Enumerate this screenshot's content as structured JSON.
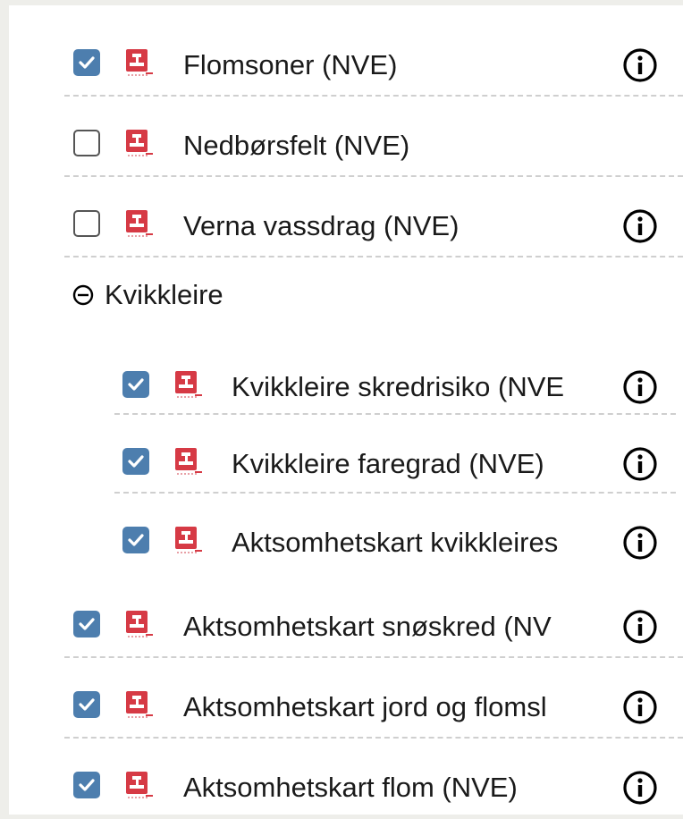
{
  "layers": [
    {
      "label": "Flomsoner (NVE)",
      "checked": true,
      "info": true
    },
    {
      "label": "Nedbørsfelt (NVE)",
      "checked": false,
      "info": false
    },
    {
      "label": "Verna vassdrag (NVE)",
      "checked": false,
      "info": true
    }
  ],
  "group": {
    "label": "Kvikkleire",
    "expanded": true,
    "children": [
      {
        "label": "Kvikkleire skredrisiko (NVE",
        "checked": true,
        "info": true
      },
      {
        "label": "Kvikkleire faregrad (NVE)",
        "checked": true,
        "info": true
      },
      {
        "label": "Aktsomhetskart kvikkleires",
        "checked": true,
        "info": true
      }
    ]
  },
  "layers_after": [
    {
      "label": "Aktsomhetskart snøskred (NV",
      "checked": true,
      "info": true
    },
    {
      "label": "Aktsomhetskart jord og flomsl",
      "checked": true,
      "info": true
    },
    {
      "label": "Aktsomhetskart flom (NVE)",
      "checked": true,
      "info": true
    }
  ],
  "colors": {
    "checkbox": "#4d7eae",
    "layer_icon": "#d63a45"
  },
  "icons": {
    "layer": "layer-icon",
    "info": "info-icon",
    "collapse": "minus-circle-icon"
  }
}
